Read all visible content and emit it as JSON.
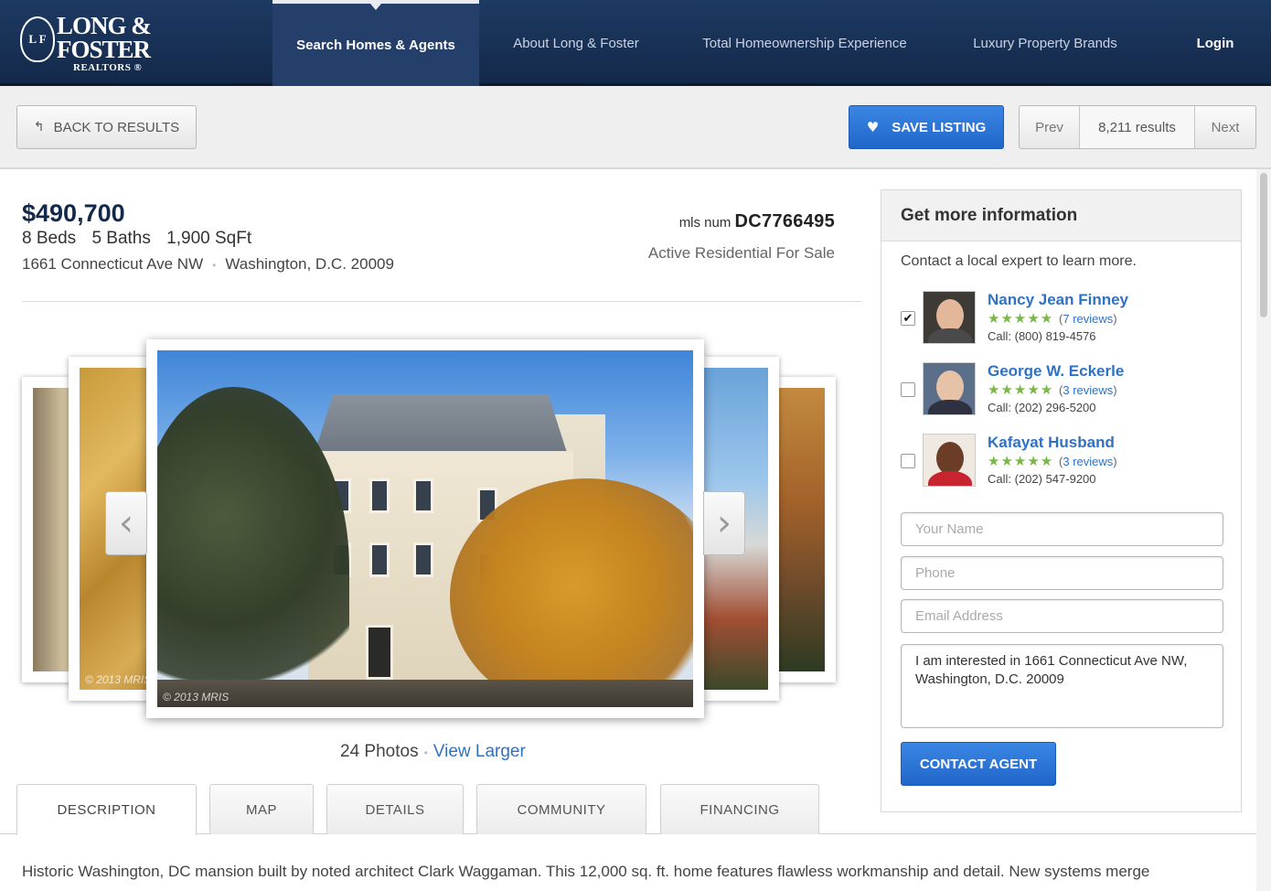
{
  "brand": {
    "seal": "L F",
    "line1": "LONG &",
    "line2": "FOSTER",
    "line3": "REALTORS ®"
  },
  "nav": {
    "items": [
      {
        "label": "Search Homes & Agents"
      },
      {
        "label": "About Long & Foster"
      },
      {
        "label": "Total Homeownership Experience"
      },
      {
        "label": "Luxury Property Brands"
      },
      {
        "label": "Login"
      }
    ]
  },
  "toolbar": {
    "back_label": "BACK TO RESULTS",
    "back_icon": "↰",
    "save_label": "SAVE LISTING",
    "save_icon": "♥",
    "prev_label": "Prev",
    "results_count": "8,211 results",
    "next_label": "Next"
  },
  "listing": {
    "price": "$490,700",
    "beds": "8 Beds",
    "baths": "5 Baths",
    "sqft": "1,900 SqFt",
    "street": "1661 Connecticut Ave NW",
    "city": "Washington, D.C. 20009",
    "mls_label": "mls num",
    "mls_number": "DC7766495",
    "status": "Active Residential For Sale"
  },
  "gallery": {
    "watermark": "© 2013 MRIS",
    "photo_count": "24 Photos",
    "separator": "•",
    "view_larger": "View Larger",
    "prev_arrow": "‹",
    "next_arrow": "›"
  },
  "tabs": [
    {
      "label": "DESCRIPTION"
    },
    {
      "label": "MAP"
    },
    {
      "label": "DETAILS"
    },
    {
      "label": "COMMUNITY"
    },
    {
      "label": "FINANCING"
    }
  ],
  "description": "Historic Washington, DC mansion built by noted architect Clark Waggaman. This 12,000 sq. ft. home features flawless workmanship and detail. New systems merge",
  "contact": {
    "title": "Get more information",
    "subtitle": "Contact a local expert to learn more.",
    "agents": [
      {
        "name": "Nancy Jean Finney",
        "stars": "★★★★★",
        "reviews": "7 reviews",
        "phone": "Call: (800) 819-4576",
        "checked": "✔"
      },
      {
        "name": "George W. Eckerle",
        "stars": "★★★★★",
        "reviews": "3 reviews",
        "phone": "Call: (202) 296-5200",
        "checked": ""
      },
      {
        "name": "Kafayat Husband",
        "stars": "★★★★★",
        "reviews": "3 reviews",
        "phone": "Call: (202) 547-9200",
        "checked": ""
      }
    ],
    "name_placeholder": "Your Name",
    "phone_placeholder": "Phone",
    "email_placeholder": "Email Address",
    "message": "I am interested in 1661 Connecticut Ave NW, Washington, D.C. 20009",
    "button_label": "CONTACT AGENT"
  },
  "colors": {
    "nav_bg": "#1d3a63",
    "accent_blue": "#2f72c4",
    "button_blue": "#2a74d6",
    "star_green": "#7ab648",
    "price_navy": "#13294b"
  }
}
